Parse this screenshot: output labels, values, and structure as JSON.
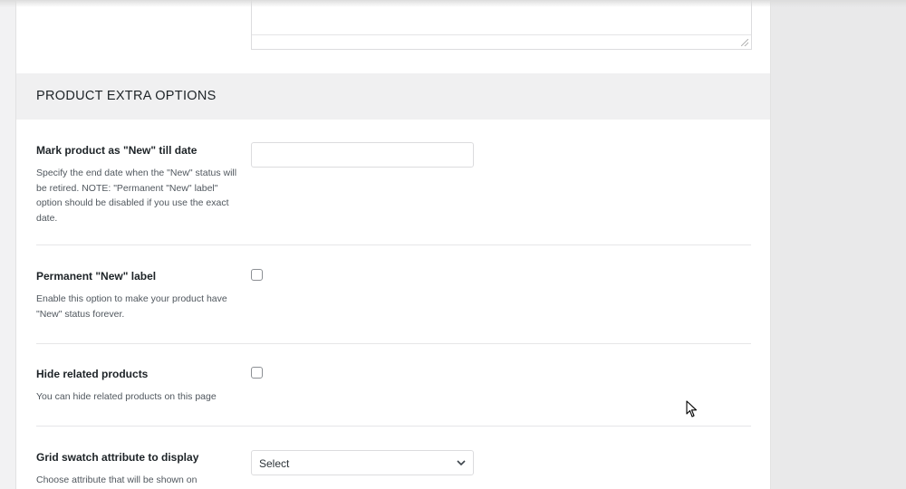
{
  "section": {
    "title": "PRODUCT EXTRA OPTIONS"
  },
  "options": [
    {
      "label": "Mark product as \"New\" till date",
      "description": "Specify the end date when the \"New\" status will be retired. NOTE: \"Permanent \"New\" label\" option should be disabled if you use the exact date.",
      "control": "date-input",
      "value": ""
    },
    {
      "label": "Permanent \"New\" label",
      "description": "Enable this option to make your product have \"New\" status forever.",
      "control": "checkbox",
      "checked": false
    },
    {
      "label": "Hide related products",
      "description": "You can hide related products on this page",
      "control": "checkbox",
      "checked": false
    },
    {
      "label": "Grid swatch attribute to display",
      "description": "Choose attribute that will be shown on",
      "control": "select",
      "value": "Select"
    }
  ],
  "icons": {
    "select_arrow": "chevron-down-icon",
    "textarea_resize": "resize-grip-icon",
    "pointer": "mouse-cursor-icon"
  }
}
